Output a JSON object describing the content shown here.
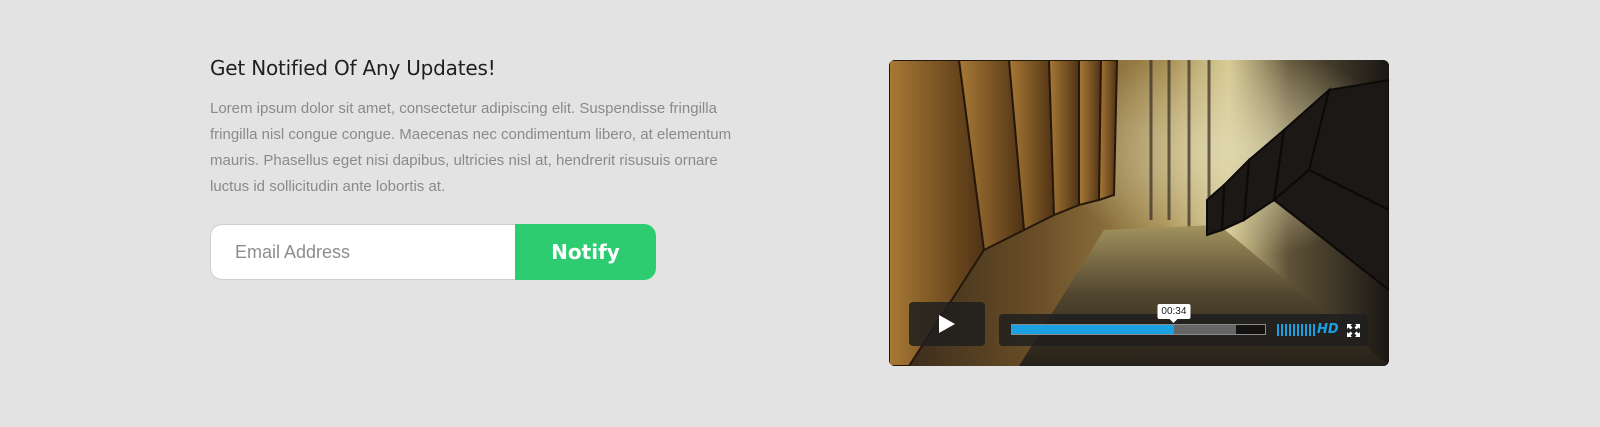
{
  "heading": "Get Notified Of Any Updates!",
  "body": "Lorem ipsum dolor sit amet, consectetur adipiscing elit. Suspendisse fringilla fringilla nisl congue congue. Maecenas nec condimentum libero, at elementum mauris. Phasellus eget nisi dapibus, ultricies nisl at, hendrerit risusuis ornare luctus id sollicitudin ante lobortis at.",
  "form": {
    "email_placeholder": "Email Address",
    "email_value": "",
    "notify_label": "Notify"
  },
  "video": {
    "current_time": "00:34",
    "played_fraction": 0.64,
    "loaded_fraction": 0.885,
    "volume_bars": 10,
    "quality_label": "HD",
    "colors": {
      "accent": "#1ba0e1",
      "button": "#2ecc71"
    },
    "icons": {
      "play": "play-icon",
      "fullscreen": "fullscreen-icon",
      "volume": "volume-level-icon"
    }
  }
}
